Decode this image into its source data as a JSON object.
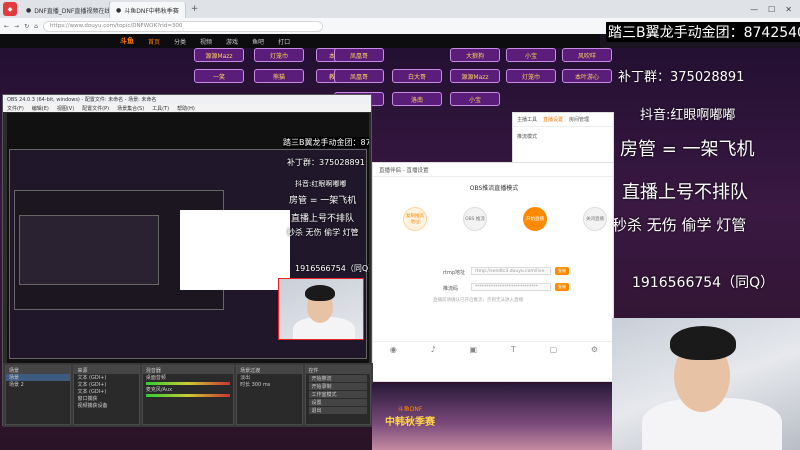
{
  "browser": {
    "tabs": [
      "DNF直播_DNF直播视频在线..",
      "斗鱼DNF中韩秋季赛"
    ],
    "tab_plus": "+",
    "address": "https://www.douyu.com/topic/DNFWOK?rid=300",
    "bookmarks": [
      "百度一下",
      "京东商城",
      "淘宝网"
    ]
  },
  "douyu": {
    "logo": "斗鱼",
    "nav": [
      "首页",
      "分类",
      "视频",
      "游戏",
      "鱼吧",
      "打口"
    ],
    "active_nav": "首页"
  },
  "pills": [
    "一笑",
    "熊猫",
    "教授阿二",
    "凤凰哥",
    "白大哥",
    "源源Mazz",
    "灯笼巾",
    "本叶游心",
    "大狼狗",
    "小宝",
    "洛南",
    "风吹咩"
  ],
  "overlay": {
    "line1": "踏三B翼龙手动金团：874254001",
    "line2": "补丁群：375028891",
    "line3": "抖音:红眼啊嘟嘟",
    "line4": "房管 = 一架飞机",
    "line5": "直播上号不排队",
    "line6": "秒杀 无伤 偷学 灯管",
    "line7": "1916566754（同Q）",
    "small_line1": "踏三B翼龙手动金团：8742540",
    "small_line2": "补丁群：375028891",
    "small_line3": "抖音:红眼啊嘟嘟",
    "small_line4": "房管 = 一架飞机",
    "small_line5": "直播上号不排队",
    "small_line6": "秒杀 无伤 偷学 灯管",
    "small_line7": "1916566754（同Q）"
  },
  "obs": {
    "title": "OBS 24.0.3 (64-bit, windows) - 配置文件: 未命名 - 场景: 未命名",
    "menu": [
      "文件(F)",
      "编辑(E)",
      "视图(V)",
      "配置文件(P)",
      "场景集合(S)",
      "工具(T)",
      "帮助(H)"
    ],
    "docks": [
      {
        "header": "场景",
        "rows": [
          "场景",
          "场景 2"
        ]
      },
      {
        "header": "来源",
        "rows": [
          "文本 (GDI+)",
          "文本 (GDI+)",
          "文本 (GDI+)",
          "窗口捕获",
          "视频捕获设备"
        ]
      },
      {
        "header": "混音器",
        "rows": [
          "桌面音频",
          "麦克风/Aux"
        ]
      },
      {
        "header": "场景过渡",
        "rows": [
          "淡出",
          "时长 300 ms"
        ]
      },
      {
        "header": "控件",
        "rows": [
          "开始推流",
          "开始录制",
          "工作室模式",
          "设置",
          "退出"
        ]
      }
    ]
  },
  "dialog": {
    "title": "直播伴侣 - 直播设置",
    "heading": "OBS推流直播模式",
    "steps": [
      "复制推流地址",
      "OBS 推流",
      "开始直播",
      "关闭直播"
    ],
    "rtmp_label": "rtmp地址",
    "rtmp_value": "rtmp://sendtc3.douyu.com/live",
    "code_label": "推流码",
    "code_value": "****************************",
    "copy_label": "复制",
    "note": "直播前请确认已开启推流，否则无法进入直播"
  },
  "mini_panel": {
    "tabs": [
      "主播工具",
      "直播设置",
      "房间管理"
    ],
    "item": "推流模式"
  },
  "poster": {
    "sub": "斗鱼DNF",
    "main": "中韩秋季赛"
  },
  "colors": {
    "accent": "#ff7a00",
    "pill_bg": "#5a1d7a",
    "pill_text": "#ffd45c"
  }
}
